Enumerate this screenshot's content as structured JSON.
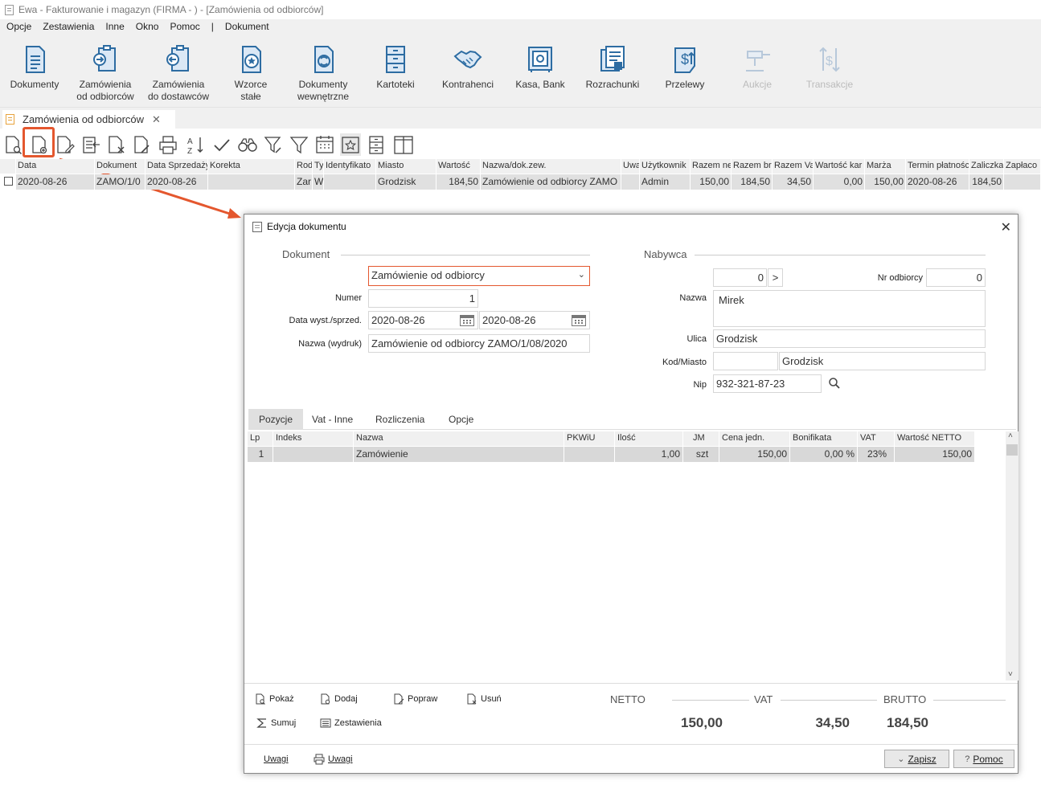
{
  "window": {
    "title": "Ewa - Fakturowanie i magazyn (FIRMA - ) - [Zamówienia od odbiorców]"
  },
  "menu": [
    "Opcje",
    "Zestawienia",
    "Inne",
    "Okno",
    "Pomoc",
    "|",
    "Dokument"
  ],
  "ribbon": [
    {
      "label": "Dokumenty",
      "icon": "document-icon",
      "enabled": true
    },
    {
      "label": "Zamówienia\nod odbiorców",
      "icon": "order-in-icon",
      "enabled": true
    },
    {
      "label": "Zamówienia\ndo dostawców",
      "icon": "order-out-icon",
      "enabled": true
    },
    {
      "label": "Wzorce\nstałe",
      "icon": "template-icon",
      "enabled": true
    },
    {
      "label": "Dokumenty\nwewnętrzne",
      "icon": "internal-doc-icon",
      "enabled": true
    },
    {
      "label": "Kartoteki",
      "icon": "cabinet-icon",
      "enabled": true
    },
    {
      "label": "Kontrahenci",
      "icon": "handshake-icon",
      "enabled": true
    },
    {
      "label": "Kasa, Bank",
      "icon": "safe-icon",
      "enabled": true
    },
    {
      "label": "Rozrachunki",
      "icon": "settlements-icon",
      "enabled": true
    },
    {
      "label": "Przelewy",
      "icon": "transfer-icon",
      "enabled": true
    },
    {
      "label": "Aukcje",
      "icon": "gavel-icon",
      "enabled": false
    },
    {
      "label": "Transakcje",
      "icon": "transactions-icon",
      "enabled": false
    }
  ],
  "doc_tab": {
    "label": "Zamówienia od odbiorców",
    "close": "✕"
  },
  "grid": {
    "headers": [
      "Data",
      "Dokument",
      "Data Sprzedaży",
      "Korekta",
      "Rod",
      "Ty",
      "Identyfikato",
      "Miasto",
      "Wartość",
      "Nazwa/dok.zew.",
      "Uwa",
      "Użytkownik",
      "Razem ne",
      "Razem br",
      "Razem Va",
      "Wartość kar",
      "Marża",
      "Termin płatności",
      "Zaliczka",
      "Zapłaco"
    ],
    "row": [
      "2020-08-26",
      "ZAMO/1/0",
      "2020-08-26",
      "",
      "Zar",
      "W",
      "",
      "Grodzisk",
      "184,50",
      "Zamówienie od odbiorcy ZAMO",
      "",
      "Admin",
      "150,00",
      "184,50",
      "34,50",
      "0,00",
      "150,00",
      "2020-08-26",
      "184,50",
      ""
    ]
  },
  "dialog": {
    "title": "Edycja dokumentu",
    "close": "✕",
    "dokument_section": "Dokument",
    "nabywca_section": "Nabywca",
    "doc_type": "Zamówienie od odbiorcy",
    "numer_label": "Numer",
    "numer": "1",
    "data_label": "Data wyst./sprzed.",
    "data_wyst": "2020-08-26",
    "data_sprzed": "2020-08-26",
    "nazwa_wydruk_label": "Nazwa (wydruk)",
    "nazwa_wydruk": "Zamówienie od odbiorcy ZAMO/1/08/2020",
    "buyer_id": "0",
    "buyer_next": ">",
    "nr_odbiorcy_label": "Nr odbiorcy",
    "nr_odbiorcy": "0",
    "nazwa_label": "Nazwa",
    "nazwa": "Mirek",
    "ulica_label": "Ulica",
    "ulica": "Grodzisk",
    "kod_label": "Kod/Miasto",
    "kod": "",
    "miasto": "Grodzisk",
    "nip_label": "Nip",
    "nip": "932-321-87-23",
    "tabs": [
      "Pozycje",
      "Vat - Inne",
      "Rozliczenia",
      "Opcje"
    ],
    "pos_headers": [
      "Lp",
      "Indeks",
      "Nazwa",
      "PKWiU",
      "Ilość",
      "JM",
      "Cena jedn.",
      "Bonifikata",
      "VAT",
      "Wartość NETTO"
    ],
    "pos_row": [
      "1",
      "",
      "Zamówienie",
      "",
      "1,00",
      "szt",
      "150,00",
      "0,00 %",
      "23%",
      "150,00"
    ],
    "actions": {
      "pokaz": "Pokaż",
      "dodaj": "Dodaj",
      "popraw": "Popraw",
      "usun": "Usuń",
      "sumuj": "Sumuj",
      "zestawienia": "Zestawienia"
    },
    "totals": {
      "netto_label": "NETTO",
      "netto": "150,00",
      "vat_label": "VAT",
      "vat": "34,50",
      "brutto_label": "BRUTTO",
      "brutto": "184,50"
    },
    "footer": {
      "uwagi1": "Uwagi",
      "uwagi2": "Uwagi",
      "zapisz": "Zapisz",
      "pomoc": "Pomoc"
    }
  },
  "colors": {
    "callout": "#e4572e",
    "chrome": "#f0f0f0",
    "selected_row": "#e0e0e0"
  }
}
